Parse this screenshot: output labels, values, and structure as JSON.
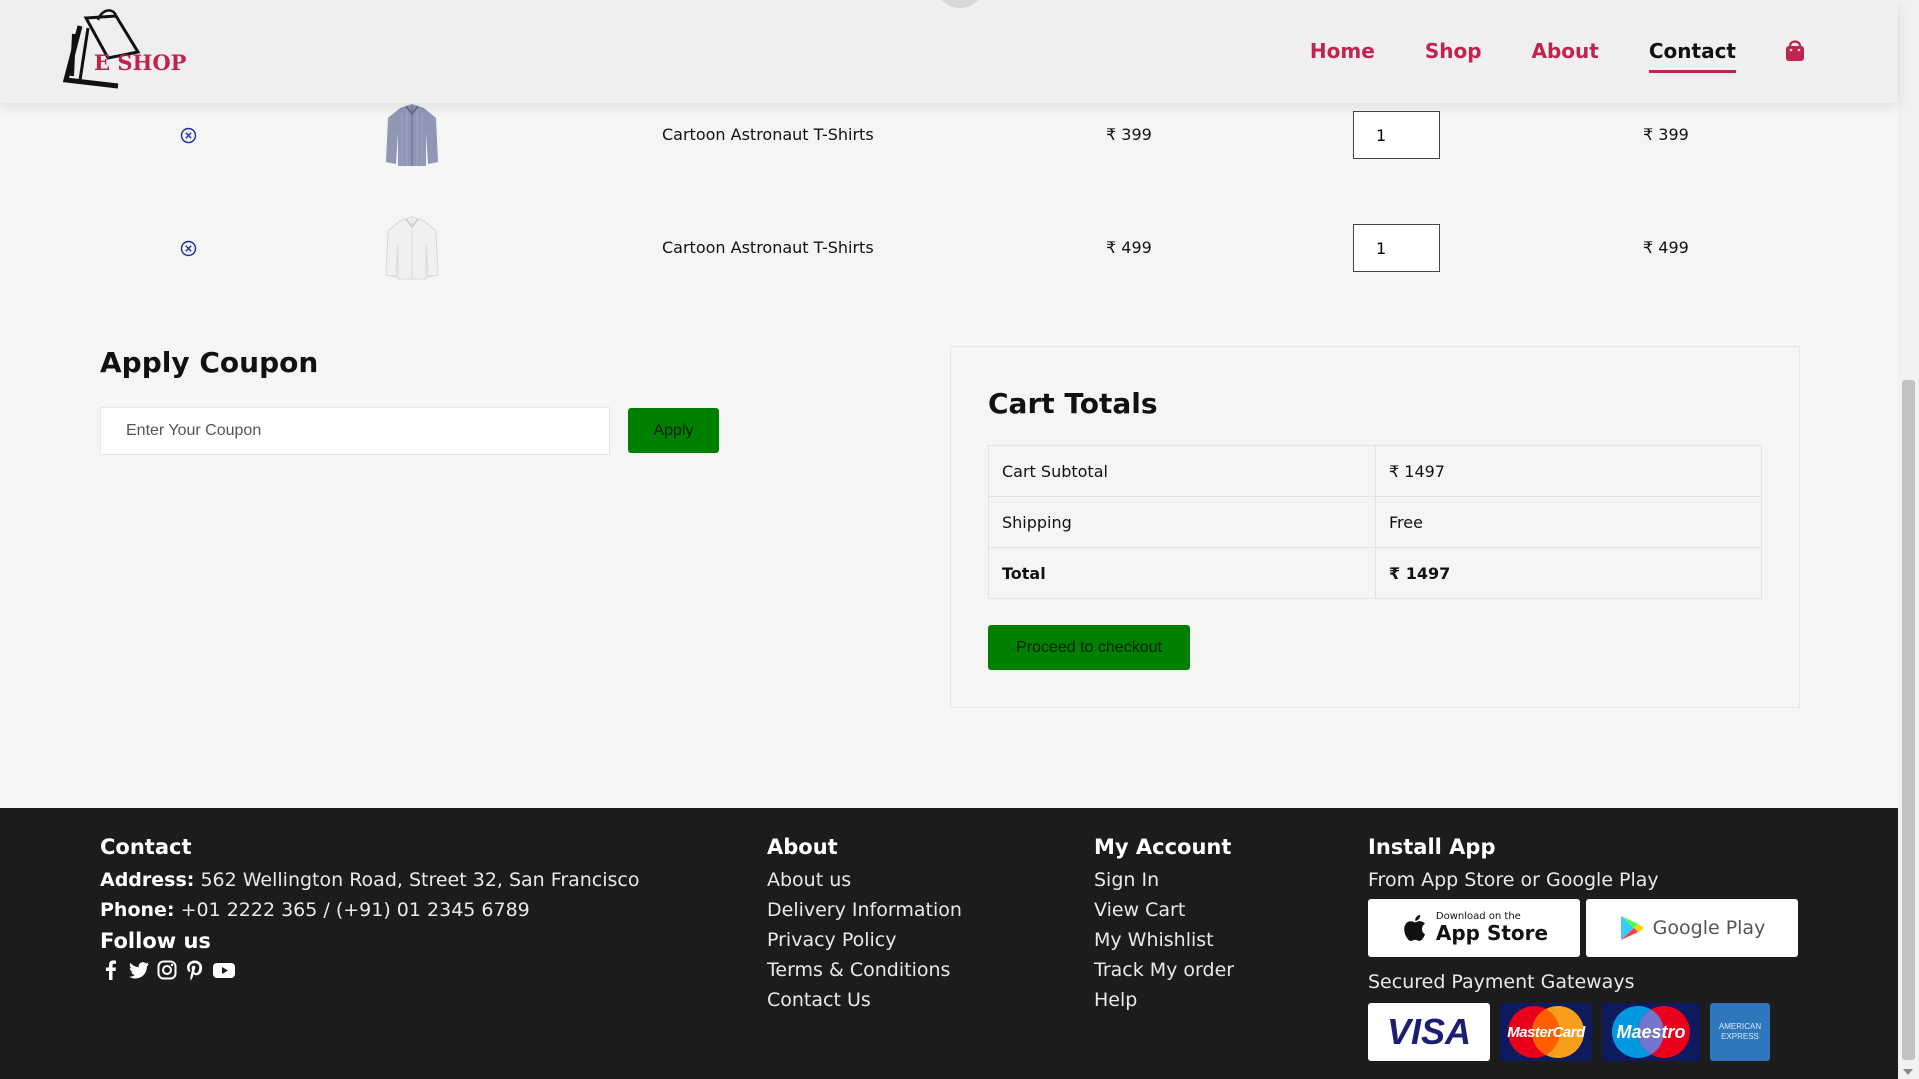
{
  "header": {
    "logo_text": "E SHOP",
    "nav": [
      {
        "label": "Home"
      },
      {
        "label": "Shop"
      },
      {
        "label": "About"
      },
      {
        "label": "Contact"
      }
    ],
    "active_nav": "Contact",
    "cart_icon": "shopping-bag-icon",
    "accent_color": "#c0244c"
  },
  "cart": {
    "items": [
      {
        "remove_icon": "remove-circle-icon",
        "image": "striped-shirt",
        "name": "Cartoon Astronaut T-Shirts",
        "price": "₹ 399",
        "qty": "1",
        "subtotal": "₹ 399"
      },
      {
        "remove_icon": "remove-circle-icon",
        "image": "white-shirt",
        "name": "Cartoon Astronaut T-Shirts",
        "price": "₹ 499",
        "qty": "1",
        "subtotal": "₹ 499"
      }
    ]
  },
  "coupon": {
    "title": "Apply Coupon",
    "placeholder": "Enter Your Coupon",
    "apply_label": "Apply"
  },
  "totals": {
    "title": "Cart Totals",
    "rows": [
      {
        "label": "Cart Subtotal",
        "value": "₹ 1497"
      },
      {
        "label": "Shipping",
        "value": "Free"
      },
      {
        "label": "Total",
        "value": "₹ 1497"
      }
    ],
    "checkout_label": "Proceed to checkout",
    "button_color": "#008000"
  },
  "footer": {
    "contact": {
      "title": "Contact",
      "address_label": "Address:",
      "address": "562 Wellington Road, Street 32, San Francisco",
      "phone_label": "Phone:",
      "phone": "+01 2222 365 / (+91) 01 2345 6789",
      "follow_title": "Follow us",
      "social_icons": [
        "facebook-icon",
        "twitter-icon",
        "instagram-icon",
        "pinterest-icon",
        "youtube-icon"
      ]
    },
    "about": {
      "title": "About",
      "links": [
        "About us",
        "Delivery Information",
        "Privacy Policy",
        "Terms & Conditions",
        "Contact Us"
      ]
    },
    "account": {
      "title": "My Account",
      "links": [
        "Sign In",
        "View Cart",
        "My Whishlist",
        "Track My order",
        "Help"
      ]
    },
    "app": {
      "title": "Install App",
      "subtitle": "From App Store or Google Play",
      "appstore_small": "Download on the",
      "appstore_big": "App Store",
      "googleplay": "Google Play",
      "payment_title": "Secured Payment Gateways",
      "payments": [
        "VISA",
        "MasterCard",
        "Maestro",
        "AMERICAN EXPRESS"
      ]
    },
    "background": "#1c1c1c"
  }
}
